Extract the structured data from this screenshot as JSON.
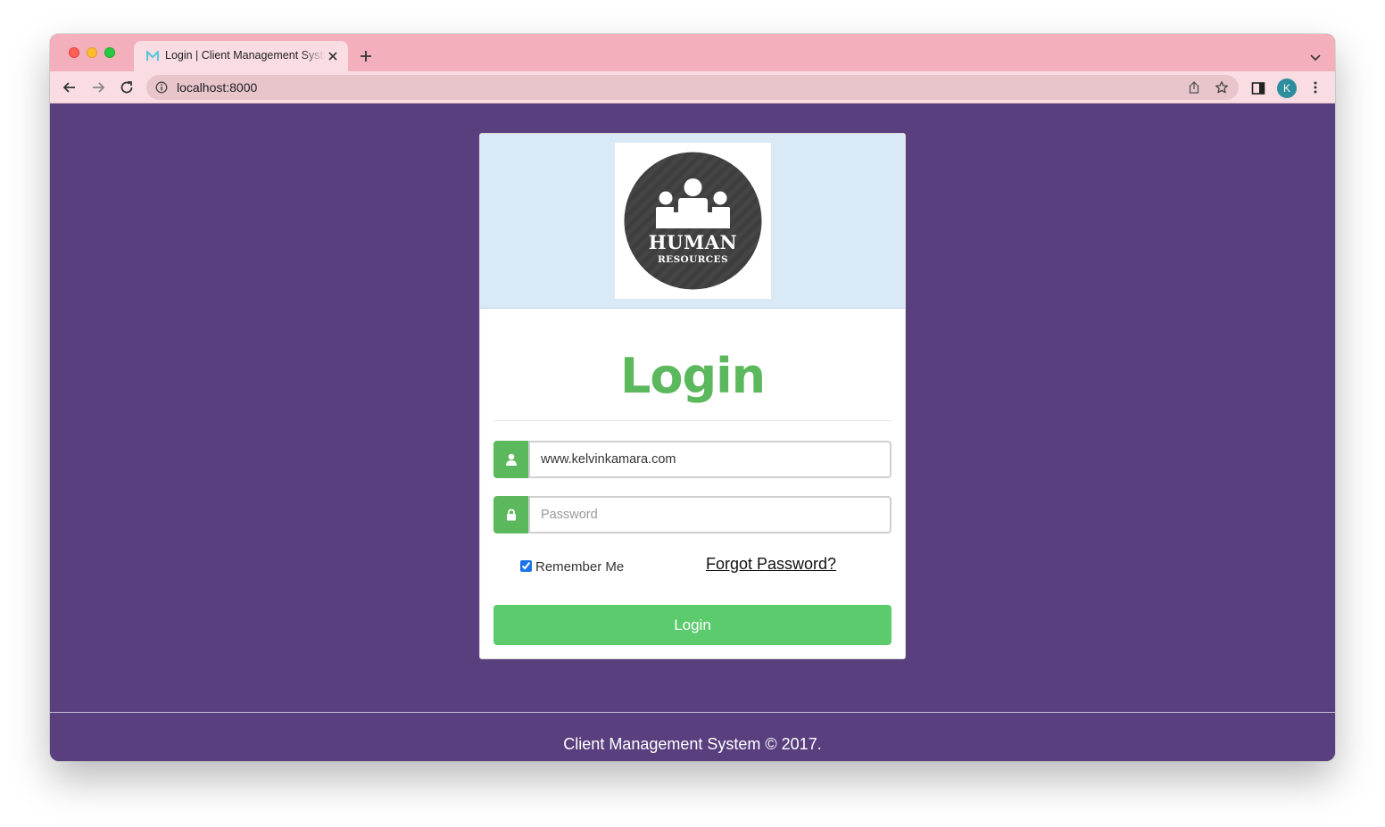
{
  "browser": {
    "tab_title": "Login | Client Management System",
    "url": "localhost:8000",
    "profile_initial": "K"
  },
  "colors": {
    "page_background": "#593f7e",
    "tab_strip": "#f4afbd",
    "header_background": "#d9eaf6",
    "accent_green": "#5cb85c",
    "login_button": "#5ccb6e"
  },
  "logo": {
    "title": "HUMAN",
    "subtitle": "RESOURCES"
  },
  "login": {
    "heading": "Login",
    "username_value": "www.kelvinkamara.com",
    "password_placeholder": "Password",
    "remember_label": "Remember Me",
    "remember_checked": true,
    "forgot_label": "Forgot Password?",
    "submit_label": "Login"
  },
  "footer": {
    "text": "Client Management System © 2017."
  },
  "icons": {
    "user_addon": "user-icon",
    "password_addon": "lock-icon"
  }
}
